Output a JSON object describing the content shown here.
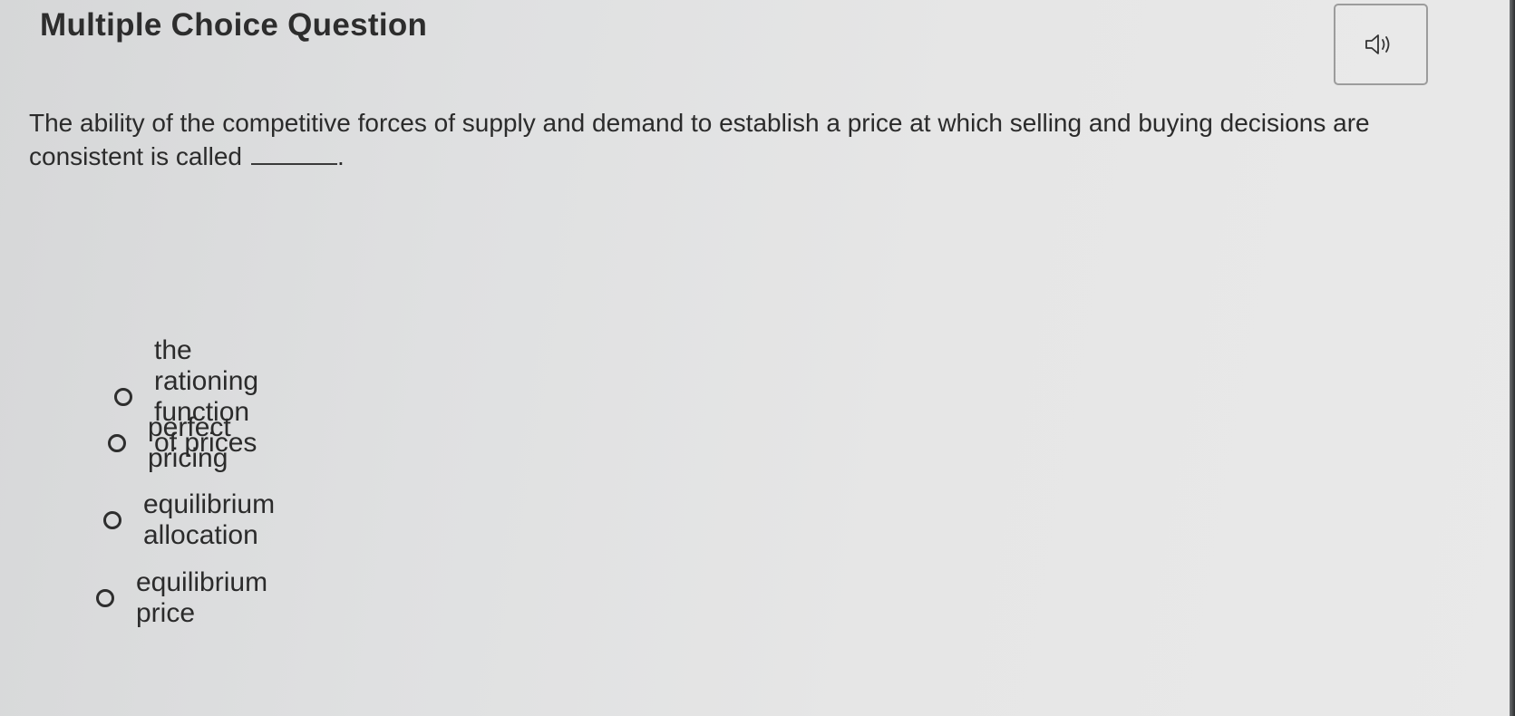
{
  "header": {
    "question_type": "Multiple Choice Question",
    "audio_icon": "speaker-icon"
  },
  "question": {
    "prompt": "The ability of the competitive forces of supply and demand to establish a price at which selling and buying decisions are consistent is called",
    "blank_suffix": "."
  },
  "options": [
    {
      "label": "the rationing function of prices",
      "selected": false
    },
    {
      "label": "perfect pricing",
      "selected": false
    },
    {
      "label": "equilibrium allocation",
      "selected": false
    },
    {
      "label": "equilibrium price",
      "selected": false
    }
  ]
}
